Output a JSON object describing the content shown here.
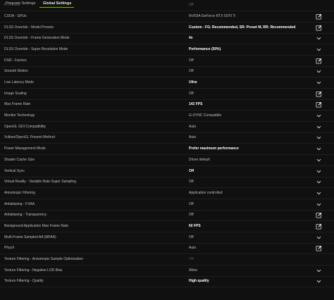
{
  "tabs": [
    {
      "label": "Program Settings",
      "active": false
    },
    {
      "label": "Global Settings",
      "active": true
    }
  ],
  "colors": {
    "accent": "#76b900",
    "background": "#101010",
    "text": "#bdbdbd",
    "value_emphasis": "#ffffff"
  },
  "partial_row": {
    "label": "RTX HDR",
    "value": "Off"
  },
  "settings": [
    {
      "label": "CUDA - GPUs",
      "value": "NVIDIA GeForce RTX 5070 Ti",
      "emphasis": false,
      "control": "edit-icon"
    },
    {
      "label": "DLSS Override - Model Presets",
      "value": "Custom - FG: Recommended, SR: Preset M, RR: Recommended",
      "emphasis": true,
      "control": "edit-icon"
    },
    {
      "label": "DLSS Override - Frame Generation Mode",
      "value": "4x",
      "emphasis": true,
      "control": "chevron-down-icon"
    },
    {
      "label": "DLSS Override - Super Resolution Mode",
      "value": "Performance (50%)",
      "emphasis": true,
      "control": "chevron-down-icon"
    },
    {
      "label": "DSR - Factors",
      "value": "Off",
      "emphasis": false,
      "control": "edit-icon"
    },
    {
      "label": "Smooth Motion",
      "value": "Off",
      "emphasis": false,
      "control": "chevron-down-icon"
    },
    {
      "label": "Low Latency Mode",
      "value": "Ultra",
      "emphasis": true,
      "control": "chevron-down-icon"
    },
    {
      "label": "Image Scaling",
      "value": "Off",
      "emphasis": false,
      "control": "edit-icon"
    },
    {
      "label": "Max Frame Rate",
      "value": "142 FPS",
      "emphasis": true,
      "control": "edit-icon"
    },
    {
      "label": "Monitor Technology",
      "value": "G-SYNC Compatible",
      "emphasis": false,
      "control": "chevron-down-icon"
    },
    {
      "label": "OpenGL GDI Compatibility",
      "value": "Auto",
      "emphasis": false,
      "control": "chevron-down-icon"
    },
    {
      "label": "Vulkan/OpenGL Present Method",
      "value": "Auto",
      "emphasis": false,
      "control": "chevron-down-icon"
    },
    {
      "label": "Power Management Mode",
      "value": "Prefer maximum performance",
      "emphasis": true,
      "control": "chevron-down-icon"
    },
    {
      "label": "Shader Cache Size",
      "value": "Driver default",
      "emphasis": false,
      "control": "chevron-down-icon"
    },
    {
      "label": "Vertical Sync",
      "value": "Off",
      "emphasis": true,
      "control": "chevron-down-icon"
    },
    {
      "label": "Virtual Reality - Variable Rate Super Sampling",
      "value": "Off",
      "emphasis": false,
      "control": "chevron-down-icon"
    },
    {
      "label": "Anisotropic Filtering",
      "value": "Application controlled",
      "emphasis": false,
      "control": "chevron-down-icon"
    },
    {
      "label": "Antialiasing - FXAA",
      "value": "Off",
      "emphasis": false,
      "control": "chevron-down-icon"
    },
    {
      "label": "Antialiasing - Transparency",
      "value": "Off",
      "emphasis": false,
      "control": "edit-icon"
    },
    {
      "label": "Background Application Max Frame Rate",
      "value": "60 FPS",
      "emphasis": true,
      "control": "edit-icon"
    },
    {
      "label": "Multi-Frame Sampled AA (MFAA)",
      "value": "Off",
      "emphasis": false,
      "control": "chevron-down-icon"
    },
    {
      "label": "PhysX",
      "value": "Auto",
      "emphasis": false,
      "control": "edit-icon"
    },
    {
      "label": "Texture Filtering - Anisotropic Sample Optimization",
      "value": "Off",
      "emphasis": false,
      "disabled": true,
      "control": "none"
    },
    {
      "label": "Texture Filtering - Negative LOD Bias",
      "value": "Allow",
      "emphasis": false,
      "control": "chevron-down-icon"
    },
    {
      "label": "Texture Filtering - Quality",
      "value": "High quality",
      "emphasis": true,
      "control": "chevron-down-icon"
    }
  ]
}
